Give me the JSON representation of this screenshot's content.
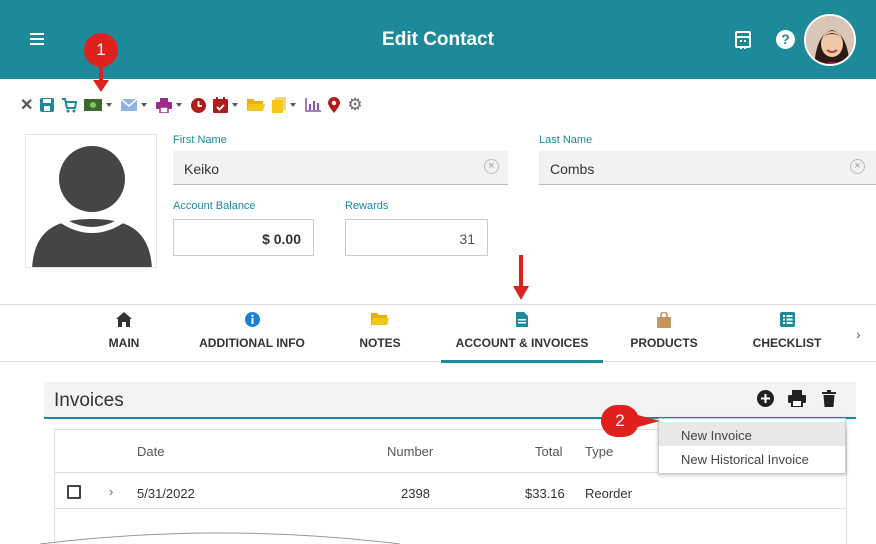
{
  "header": {
    "title": "Edit Contact"
  },
  "colors": {
    "teal": "#1d8a99",
    "red": "#e0201c"
  },
  "toolbar": {
    "icons": [
      "close-icon",
      "save-icon",
      "cart-icon",
      "money-icon",
      "email-icon",
      "print-icon",
      "clock-icon",
      "calendar-check-icon",
      "folder-icon",
      "documents-icon",
      "chart-icon",
      "map-marker-icon",
      "gear-icon"
    ]
  },
  "form": {
    "first_name_label": "First Name",
    "first_name": "Keiko",
    "last_name_label": "Last Name",
    "last_name": "Combs",
    "account_balance_label": "Account Balance",
    "account_balance": "$ 0.00",
    "rewards_label": "Rewards",
    "rewards": "31"
  },
  "tabs": [
    {
      "label": "MAIN",
      "icon": "home-icon"
    },
    {
      "label": "ADDITIONAL INFO",
      "icon": "info-icon"
    },
    {
      "label": "NOTES",
      "icon": "folder-icon"
    },
    {
      "label": "ACCOUNT & INVOICES",
      "icon": "file-icon",
      "active": true
    },
    {
      "label": "PRODUCTS",
      "icon": "bag-icon"
    },
    {
      "label": "CHECKLIST",
      "icon": "checklist-icon"
    }
  ],
  "invoices": {
    "title": "Invoices",
    "columns": {
      "date": "Date",
      "number": "Number",
      "total": "Total",
      "type": "Type"
    },
    "rows": [
      {
        "date": "5/31/2022",
        "number": "2398",
        "total": "$33.16",
        "type": "Reorder"
      }
    ],
    "menu": [
      "New Invoice",
      "New Historical Invoice"
    ]
  },
  "callouts": [
    "1",
    "2"
  ]
}
